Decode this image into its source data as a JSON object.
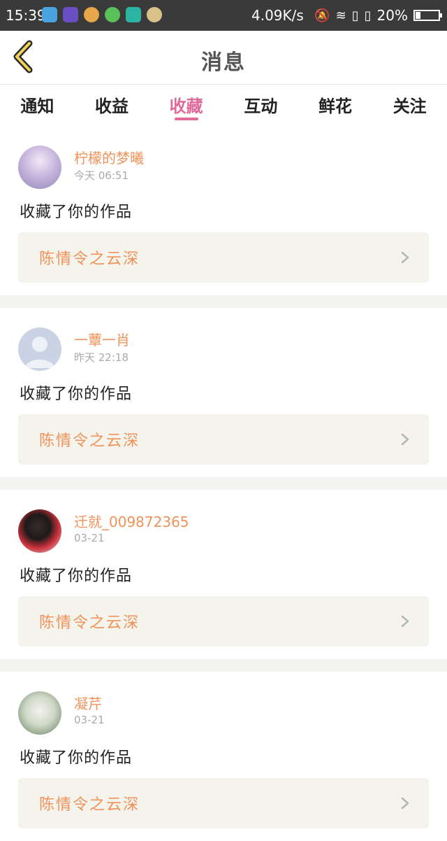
{
  "status_bar": {
    "time": "15:39",
    "net_speed": "4.09K/s",
    "battery": "20%",
    "battery_level": 0.2
  },
  "header": {
    "title": "消息"
  },
  "tabs": [
    {
      "label": "通知",
      "active": false
    },
    {
      "label": "收益",
      "active": false
    },
    {
      "label": "收藏",
      "active": true
    },
    {
      "label": "互动",
      "active": false
    },
    {
      "label": "鲜花",
      "active": false
    },
    {
      "label": "关注",
      "active": false
    }
  ],
  "items": [
    {
      "user": "柠檬的梦曦",
      "time": "今天 06:51",
      "action": "收藏了你的作品",
      "work": "陈情令之云深"
    },
    {
      "user": "一蕈一肖",
      "time": "昨天 22:18",
      "action": "收藏了你的作品",
      "work": "陈情令之云深"
    },
    {
      "user": "迁就_009872365",
      "time": "03-21",
      "action": "收藏了你的作品",
      "work": "陈情令之云深"
    },
    {
      "user": "凝芹",
      "time": "03-21",
      "action": "收藏了你的作品",
      "work": "陈情令之云深"
    }
  ],
  "colors": {
    "accent": "#e06b9a",
    "orange": "#f0925a",
    "card_bg": "#f4f3ec"
  }
}
